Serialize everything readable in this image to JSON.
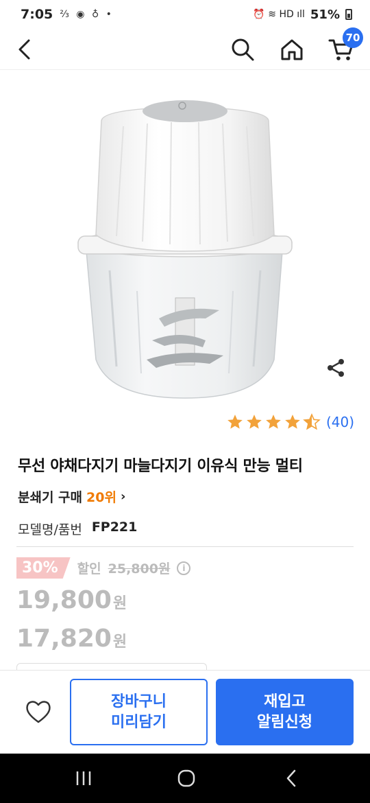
{
  "status_bar": {
    "time": "7:05",
    "left_icons": "⅔ ◉ ♁ •",
    "right_icons": "⏰ ≋ HD ıll",
    "battery": "51%"
  },
  "nav": {
    "cart_count": "70",
    "icons": [
      "back-icon",
      "search-icon",
      "home-icon",
      "cart-icon"
    ]
  },
  "product": {
    "rating_stars": 4.5,
    "review_count": "(40)",
    "title": "무선 야채다지기 마늘다지기 이유식 만능 멀티",
    "rank_prefix": "분쇄기 구매",
    "rank": "20위",
    "rank_chevron": "›",
    "model_label": "모델명/품번",
    "model_value": "FP221"
  },
  "pricing": {
    "discount_badge": "30%",
    "discount_label": "할인",
    "original_price": "25,800원",
    "info_icon": "i",
    "price_1": "19,800",
    "price_2": "17,820",
    "currency": "원"
  },
  "bottom_bar": {
    "cart_button_line1": "장바구니",
    "cart_button_line2": "미리담기",
    "restock_button_line1": "재입고",
    "restock_button_line2": "알림신청"
  },
  "colors": {
    "accent": "#2a6ff0",
    "rank": "#f07a00",
    "star": "#f2a23a",
    "discount": "#f7c4c4",
    "muted": "#bbbbbb"
  }
}
